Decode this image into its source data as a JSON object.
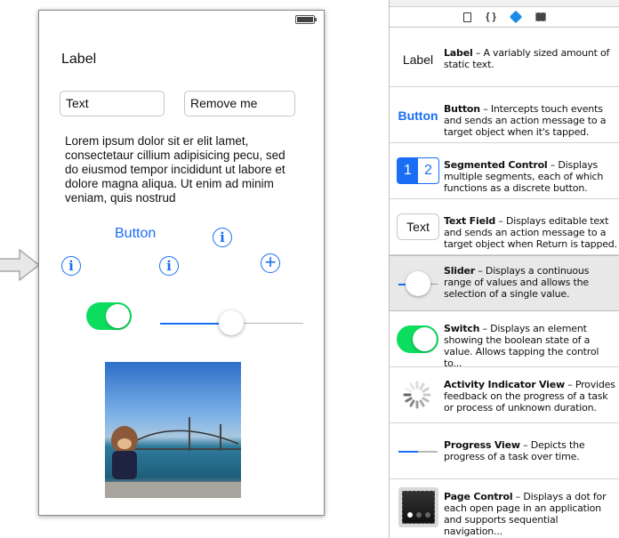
{
  "canvas": {
    "label": "Label",
    "text_field_1": "Text",
    "text_field_2": "Remove me",
    "text_view": "Lorem ipsum dolor sit er elit lamet, consectetaur cillium adipisicing pecu, sed do eiusmod tempor incididunt ut labore et dolore magna aliqua. Ut enim ad minim veniam, quis nostrud",
    "button_label": "Button",
    "info_glyph": "i",
    "plus_glyph": "+",
    "switch_on": true,
    "slider_value": 0.5
  },
  "library": {
    "tabs": [
      "file-icon",
      "braces-icon",
      "object-cube-icon",
      "media-icon"
    ],
    "braces_glyph": "{ }",
    "items": [
      {
        "title": "Label",
        "desc": " – A variably sized amount of static text.",
        "preview": "Label"
      },
      {
        "title": "Button",
        "desc": " – Intercepts touch events and sends an action message to a target object when it's tapped.",
        "preview": "Button"
      },
      {
        "title": "Segmented Control",
        "desc": " – Displays multiple segments, each of which functions as a discrete button.",
        "preview": [
          "1",
          "2"
        ]
      },
      {
        "title": "Text Field",
        "desc": " – Displays editable text and sends an action message to a target object when Return is tapped.",
        "preview": "Text"
      },
      {
        "title": "Slider",
        "desc": " – Displays a continuous range of values and allows the selection of a single value."
      },
      {
        "title": "Switch",
        "desc": " – Displays an element showing the boolean state of a value. Allows tapping the control to..."
      },
      {
        "title": "Activity Indicator View",
        "desc": " – Provides feedback on the progress of a task or process of unknown duration."
      },
      {
        "title": "Progress View",
        "desc": " – Depicts the progress of a task over time."
      },
      {
        "title": "Page Control",
        "desc": " – Displays a dot for each open page in an application and supports sequential navigation..."
      }
    ]
  },
  "colors": {
    "accent": "#1a6ef5",
    "switch_on": "#0ddd5e"
  }
}
